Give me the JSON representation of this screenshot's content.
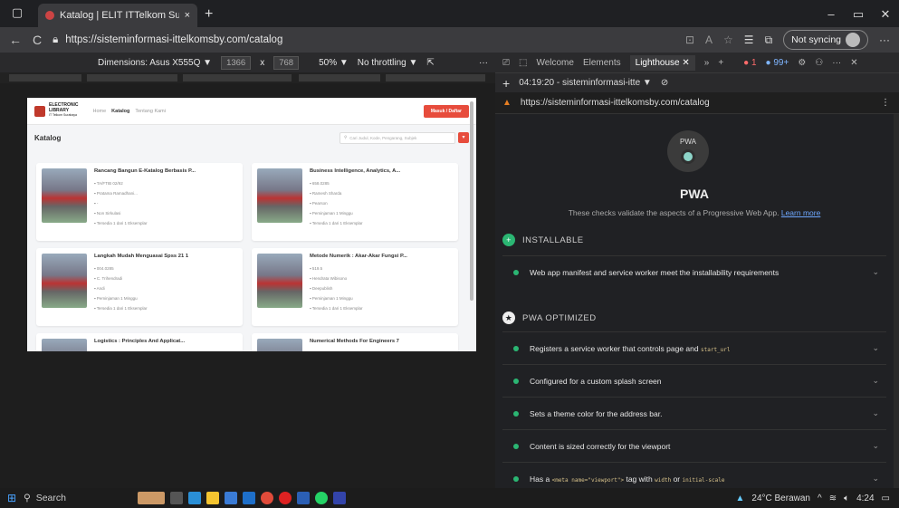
{
  "browser": {
    "tab_title": "Katalog | ELIT ITTelkom Surabaya",
    "tab_close": "×",
    "new_tab": "+",
    "url": "https://sisteminformasi-ittelkomsby.com/catalog",
    "sync_label": "Not syncing",
    "back_icon": "←",
    "reload_icon": "C",
    "more": "···"
  },
  "device_toolbar": {
    "dimensions_label": "Dimensions: Asus X555Q ▼",
    "width": "1366",
    "times": "x",
    "height": "768",
    "zoom": "50% ▼",
    "throttle": "No throttling ▼",
    "more": "···"
  },
  "site": {
    "logo_line1": "ELECTRONIC",
    "logo_line2": "LIBRARY",
    "logo_line3": "IT Telkom Surabaya",
    "nav": [
      "Home",
      "Katalog",
      "Tentang Kami"
    ],
    "login_button": "Masuk / Daftar",
    "page_title": "Katalog",
    "search_placeholder": "Cari Judul, Kode, Pengarang, Subjek",
    "cards": [
      {
        "title": "Rancang Bangun E-Katalog Berbasis P...",
        "code": "TA/FTIB 02/92",
        "author": "Pratama Ramadhani...",
        "publisher": "-",
        "type": "Non Sirkulasi",
        "availability": "Tersedia 1 dari 1 Eksemplar"
      },
      {
        "title": "Business Intelligence, Analytics, A...",
        "code": "658.0285",
        "author": "Ramesh Sharda",
        "publisher": "Pearson",
        "type": "Peminjaman 1 Minggu",
        "availability": "Tersedia 1 dari 1 Eksemplar"
      },
      {
        "title": "Langkah Mudah Menguasai Spss 21 1",
        "code": "004.0285",
        "author": "C. Trihendradi",
        "publisher": "Andi",
        "type": "Peminjaman 1 Minggu",
        "availability": "Tersedia 1 dari 1 Eksemplar"
      },
      {
        "title": "Metode Numerik : Akar-Akar Fungsi P...",
        "code": "519.5",
        "author": "Hendrata Wibisono",
        "publisher": "Deepublish",
        "type": "Peminjaman 1 Minggu",
        "availability": "Tersedia 1 dari 1 Eksemplar"
      },
      {
        "title": "Logistics : Principles And Applicat...",
        "code": "",
        "author": "",
        "publisher": "",
        "type": "",
        "availability": ""
      },
      {
        "title": "Numerical Methods For Engineers 7",
        "code": "",
        "author": "",
        "publisher": "",
        "type": "",
        "availability": ""
      }
    ]
  },
  "devtools": {
    "tabs": [
      "Welcome",
      "Elements",
      "Lighthouse"
    ],
    "errors": "● 1",
    "warnings": "● 99+",
    "report_time": "04:19:20 - sisteminformasi-itte ▼",
    "report_url": "https://sisteminformasi-ittelkomsby.com/catalog",
    "pwa_badge": "PWA",
    "pwa_title": "PWA",
    "pwa_desc": "These checks validate the aspects of a Progressive Web App.",
    "learn_more": "Learn more",
    "installable_label": "INSTALLABLE",
    "installable_audits": [
      {
        "text": "Web app manifest and service worker meet the installability requirements"
      }
    ],
    "optimized_label": "PWA OPTIMIZED",
    "audit_sw_prefix": "Registers a service worker that controls page and",
    "audit_sw_code": "start_url",
    "audit_splash": "Configured for a custom splash screen",
    "audit_theme": "Sets a theme color for the address bar.",
    "audit_viewport_size": "Content is sized correctly for the viewport",
    "audit_meta_prefix": "Has a",
    "audit_meta_code1": "<meta name=\"viewport\">",
    "audit_meta_mid1": "tag with",
    "audit_meta_code2": "width",
    "audit_meta_mid2": "or",
    "audit_meta_code3": "initial-scale"
  },
  "taskbar": {
    "search": "Search",
    "weather": "24°C Berawan",
    "time": "4:24"
  },
  "colors": {
    "accent_red": "#e74c3c",
    "pass_green": "#2bb673",
    "link_blue": "#6ea8ff"
  }
}
